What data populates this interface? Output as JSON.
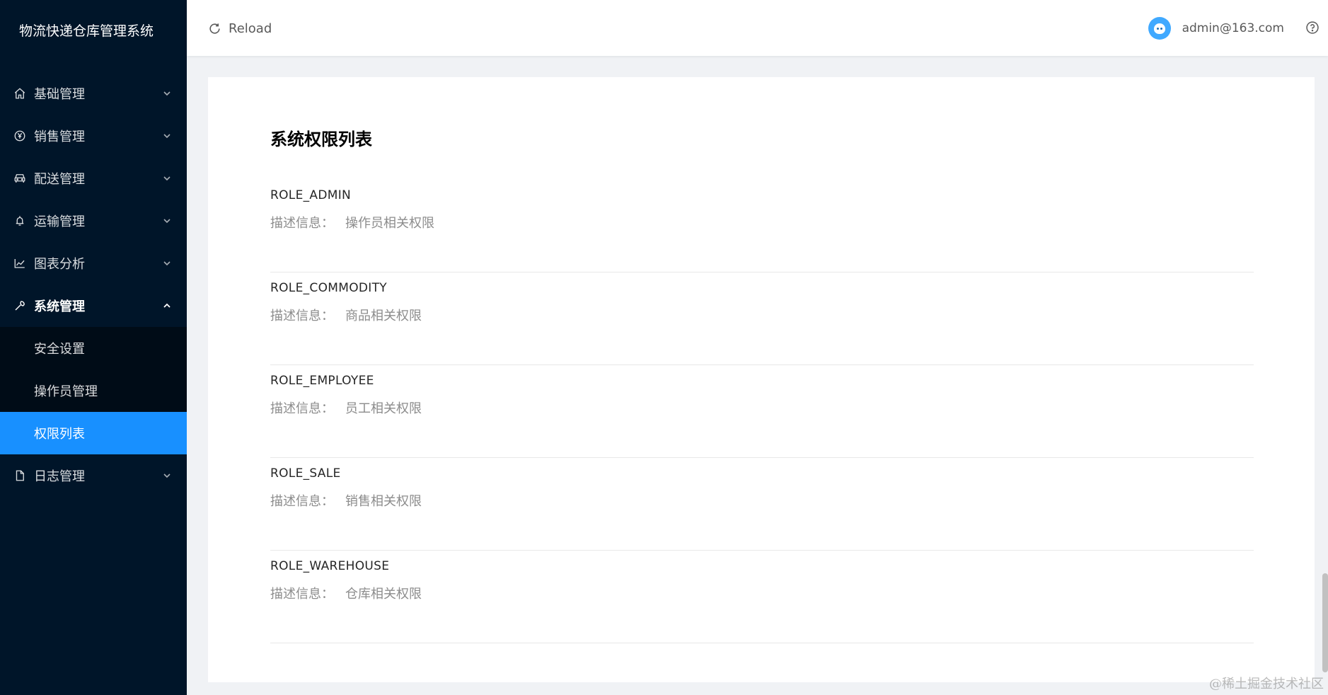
{
  "app": {
    "title": "物流快递仓库管理系统"
  },
  "sidebar": {
    "menu": [
      {
        "label": "基础管理",
        "icon": "home-icon",
        "open": false
      },
      {
        "label": "销售管理",
        "icon": "yen-circle-icon",
        "open": false
      },
      {
        "label": "配送管理",
        "icon": "car-icon",
        "open": false
      },
      {
        "label": "运输管理",
        "icon": "bell-icon",
        "open": false
      },
      {
        "label": "图表分析",
        "icon": "line-chart-icon",
        "open": false
      },
      {
        "label": "系统管理",
        "icon": "wrench-icon",
        "open": true
      }
    ],
    "submenu": [
      {
        "label": "安全设置",
        "active": false
      },
      {
        "label": "操作员管理",
        "active": false
      },
      {
        "label": "权限列表",
        "active": true
      }
    ],
    "menu_after": [
      {
        "label": "日志管理",
        "icon": "file-icon",
        "open": false
      }
    ]
  },
  "header": {
    "reload_label": "Reload",
    "reload_icon": "reload-icon",
    "user_email": "admin@163.com",
    "avatar_icon": "avatar-icon",
    "help_icon": "question-circle-icon"
  },
  "main": {
    "title": "系统权限列表",
    "desc_label": "描述信息：",
    "roles": [
      {
        "name": "ROLE_ADMIN",
        "description": "操作员相关权限"
      },
      {
        "name": "ROLE_COMMODITY",
        "description": "商品相关权限"
      },
      {
        "name": "ROLE_EMPLOYEE",
        "description": "员工相关权限"
      },
      {
        "name": "ROLE_SALE",
        "description": "销售相关权限"
      },
      {
        "name": "ROLE_WAREHOUSE",
        "description": "仓库相关权限"
      }
    ]
  },
  "watermark": "@稀土掘金技术社区",
  "colors": {
    "sidebar_bg": "#001529",
    "submenu_bg": "#000c17",
    "accent": "#1890ff",
    "page_bg": "#f0f2f5"
  }
}
